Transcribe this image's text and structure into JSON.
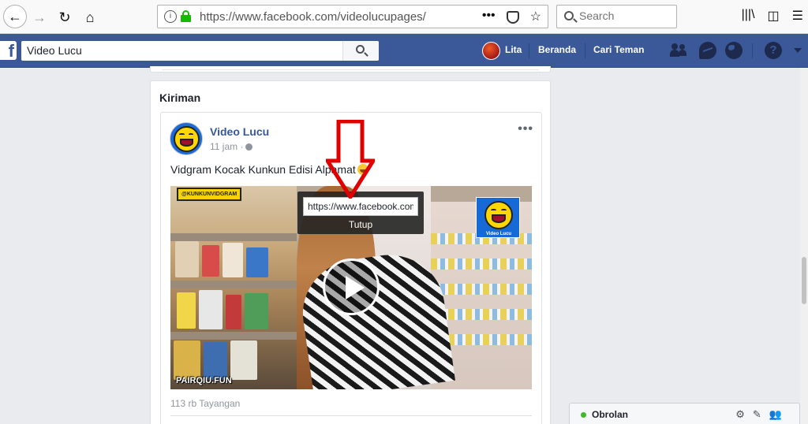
{
  "browser": {
    "url": "https://www.facebook.com/videolucupages/",
    "search_placeholder": "Search",
    "info_glyph": "i",
    "more_glyph": "•••",
    "bookmark_glyph": "☆",
    "library_glyph": "|||\\",
    "sidebar_glyph": "◫",
    "menu_glyph": "☰",
    "back_glyph": "←",
    "forward_glyph": "→",
    "reload_glyph": "↻",
    "home_glyph": "⌂"
  },
  "facebook": {
    "logo": "f",
    "search_value": "Video Lucu",
    "profile_name": "Lita",
    "nav_home": "Beranda",
    "nav_find_friends": "Cari Teman",
    "help_glyph": "?",
    "colors": {
      "brand_blue": "#3b5998",
      "link_blue": "#365899",
      "online_green": "#42b72a"
    }
  },
  "section": {
    "title": "Kiriman"
  },
  "post": {
    "page_name": "Video Lucu",
    "time": "11 jam ·",
    "more_glyph": "•••",
    "text": "Vidgram Kocak Kunkun Edisi Alpamat",
    "views": "113 rb Tayangan",
    "video": {
      "watermark": "@KUNKUNVIDGRAM",
      "brand": "PAIRQIU.FUN",
      "logo_caption": "Video Lucu"
    },
    "link_tooltip": {
      "url": "https://www.facebook.com/videolucupages/videos/",
      "close_label": "Tutup"
    }
  },
  "annotation": {
    "arrow_color": "#e00000"
  },
  "chat": {
    "label": "Obrolan",
    "settings_glyph": "⚙",
    "compose_glyph": "✎",
    "people_glyph": "👥"
  }
}
